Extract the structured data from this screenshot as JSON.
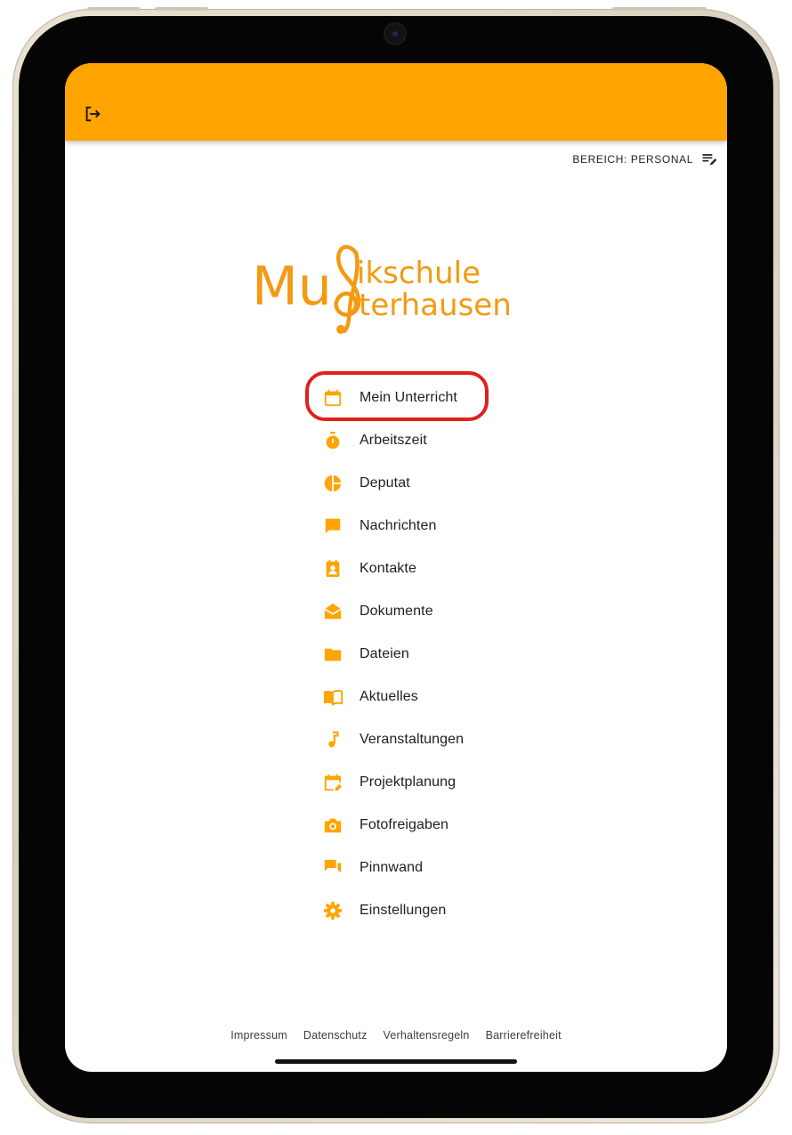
{
  "header": {
    "logout_icon": "logout-icon",
    "background": "#FFA400"
  },
  "area": {
    "label": "BEREICH: PERSONAL",
    "icon": "edit-list-icon"
  },
  "logo": {
    "line1_a": "Mu",
    "line1_b": "ikschule",
    "line2": "terhausen",
    "color": "#F39A12"
  },
  "menu": {
    "items": [
      {
        "label": "Mein Unterricht",
        "icon": "calendar-icon"
      },
      {
        "label": "Arbeitszeit",
        "icon": "stopwatch-icon"
      },
      {
        "label": "Deputat",
        "icon": "pie-chart-icon"
      },
      {
        "label": "Nachrichten",
        "icon": "chat-bubble-icon"
      },
      {
        "label": "Kontakte",
        "icon": "contact-card-icon"
      },
      {
        "label": "Dokumente",
        "icon": "open-envelope-icon"
      },
      {
        "label": "Dateien",
        "icon": "folder-icon"
      },
      {
        "label": "Aktuelles",
        "icon": "open-book-icon"
      },
      {
        "label": "Veranstaltungen",
        "icon": "music-note-icon"
      },
      {
        "label": "Projektplanung",
        "icon": "calendar-edit-icon"
      },
      {
        "label": "Fotofreigaben",
        "icon": "camera-icon"
      },
      {
        "label": "Pinnwand",
        "icon": "forum-icon"
      },
      {
        "label": "Einstellungen",
        "icon": "gear-icon"
      }
    ],
    "highlighted_index": 0,
    "icon_color": "#FFA400",
    "highlight_color": "#E0201C"
  },
  "footer": {
    "links": [
      "Impressum",
      "Datenschutz",
      "Verhaltensregeln",
      "Barrierefreiheit"
    ]
  }
}
